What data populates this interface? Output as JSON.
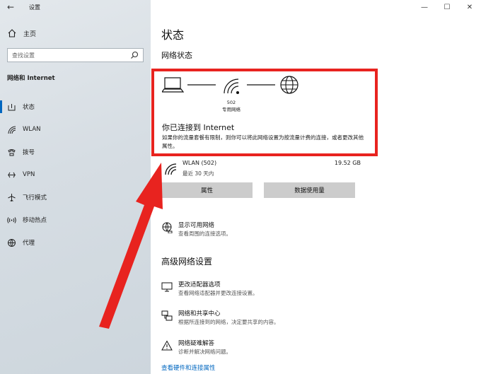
{
  "window": {
    "title": "设置",
    "back": "←",
    "minimize": "—",
    "maximize": "☐",
    "close": "✕"
  },
  "sidebar": {
    "home": "主页",
    "search_placeholder": "查找设置",
    "section": "网络和 Internet",
    "items": [
      {
        "label": "状态",
        "icon": "status-icon"
      },
      {
        "label": "WLAN",
        "icon": "wifi-icon"
      },
      {
        "label": "拨号",
        "icon": "dialup-icon"
      },
      {
        "label": "VPN",
        "icon": "vpn-icon"
      },
      {
        "label": "飞行模式",
        "icon": "airplane-icon"
      },
      {
        "label": "移动热点",
        "icon": "hotspot-icon"
      },
      {
        "label": "代理",
        "icon": "proxy-icon"
      }
    ]
  },
  "main": {
    "title": "状态",
    "network_status": "网络状态",
    "diagram": {
      "network_id": "502",
      "network_type": "专用网络"
    },
    "connected_title": "你已连接到 Internet",
    "connected_desc": "如果你的流量套餐有限制，则你可以将此网络设置为按流量计费的连接，或者更改其他属性。",
    "wlan": {
      "name": "WLAN (502)",
      "sub": "最近 30 天内",
      "size": "19.52 GB"
    },
    "buttons": {
      "properties": "属性",
      "data_usage": "数据使用量"
    },
    "show_networks": {
      "title": "显示可用网络",
      "desc": "查看周围的连接选项。"
    },
    "advanced_head": "高级网络设置",
    "advanced": [
      {
        "title": "更改适配器选项",
        "desc": "查看网络适配器并更改连接设置。",
        "icon": "adapter-icon"
      },
      {
        "title": "网络和共享中心",
        "desc": "根据所连接到的网络，决定要共享的内容。",
        "icon": "sharing-icon"
      },
      {
        "title": "网络疑难解答",
        "desc": "诊断并解决网络问题。",
        "icon": "warning-icon"
      }
    ],
    "hardware_link": "查看硬件和连接属性"
  },
  "colors": {
    "accent": "#0067c0",
    "highlight": "#e8231f"
  }
}
